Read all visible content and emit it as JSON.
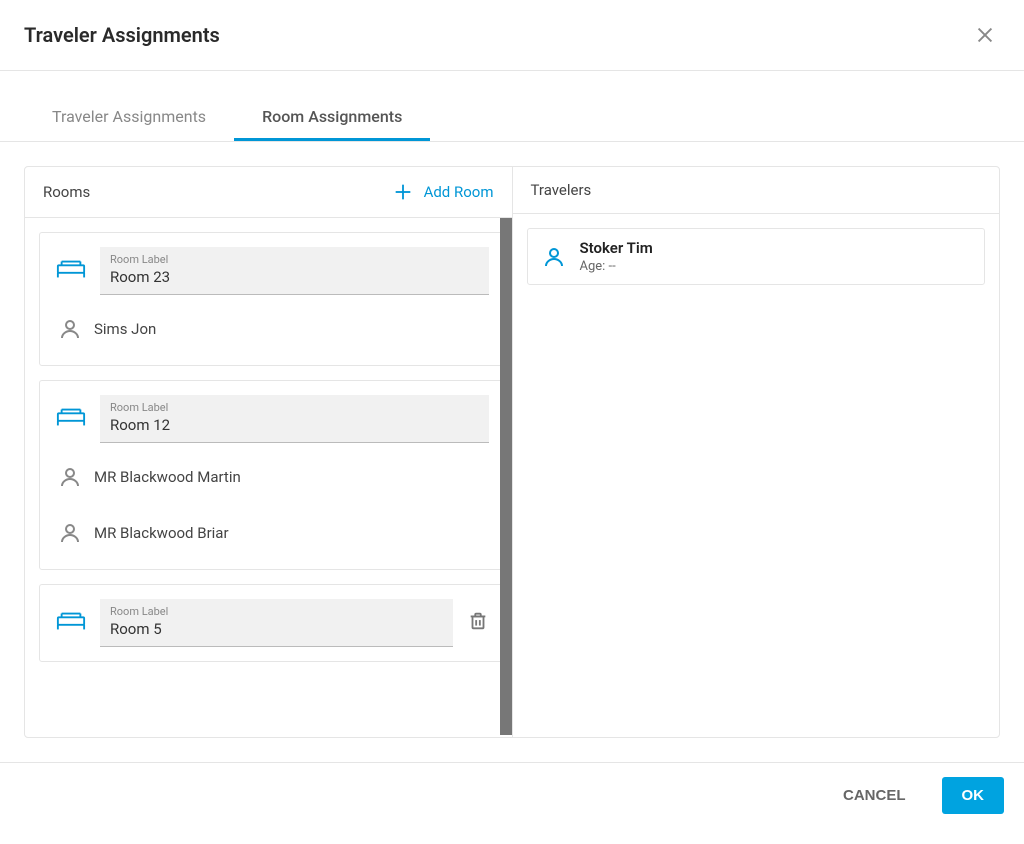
{
  "dialog": {
    "title": "Traveler Assignments"
  },
  "tabs": [
    {
      "label": "Traveler Assignments"
    },
    {
      "label": "Room Assignments"
    }
  ],
  "rooms_panel": {
    "title": "Rooms",
    "add_label": "Add Room",
    "field_label": "Room Label"
  },
  "travelers_panel": {
    "title": "Travelers"
  },
  "rooms": [
    {
      "label": "Room 23",
      "show_delete": false,
      "occupants": [
        {
          "name": "Sims Jon"
        }
      ]
    },
    {
      "label": "Room 12",
      "show_delete": false,
      "occupants": [
        {
          "name": "MR Blackwood Martin"
        },
        {
          "name": "MR Blackwood Briar"
        }
      ]
    },
    {
      "label": "Room 5",
      "show_delete": true,
      "occupants": []
    }
  ],
  "travelers": [
    {
      "name": "Stoker Tim",
      "age_label": "Age: --"
    }
  ],
  "footer": {
    "cancel": "CANCEL",
    "ok": "OK"
  },
  "colors": {
    "accent": "#0096d6",
    "primary_btn": "#00a3e0"
  }
}
